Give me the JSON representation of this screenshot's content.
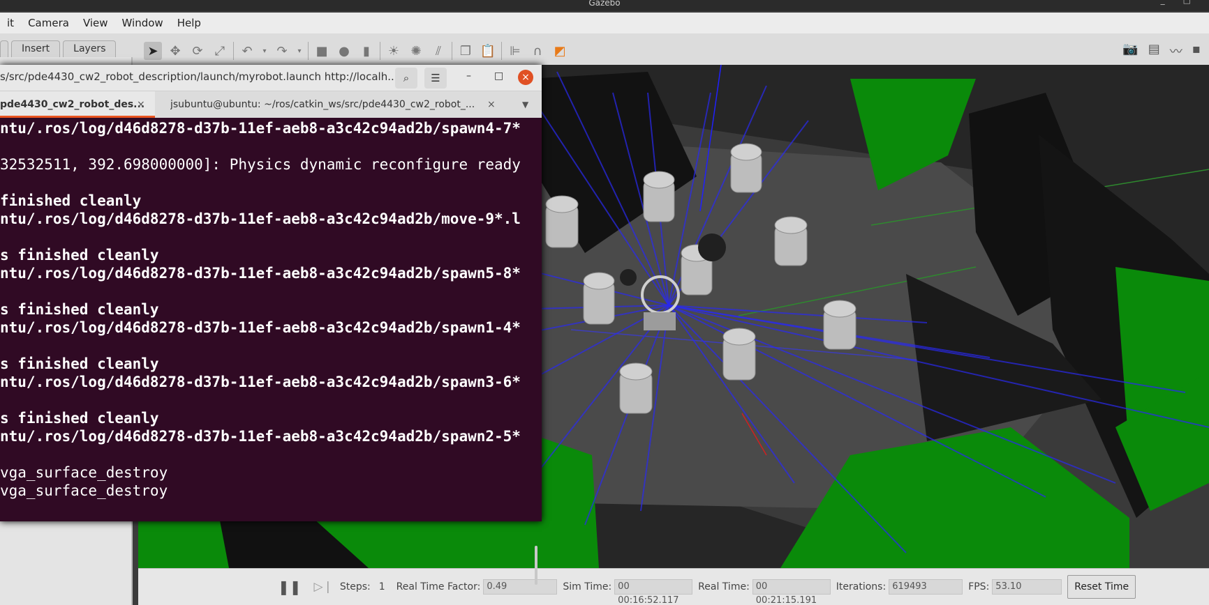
{
  "gazebo": {
    "title": "Gazebo",
    "menu": [
      "it",
      "Camera",
      "View",
      "Window",
      "Help"
    ],
    "left_tabs": [
      "Insert",
      "Layers"
    ],
    "toolbar_icons": [
      "select-arrow-icon",
      "translate-icon",
      "rotate-icon",
      "scale-icon",
      "undo-icon",
      "undo-dropdown-icon",
      "redo-icon",
      "redo-dropdown-icon",
      "box-icon",
      "sphere-icon",
      "cylinder-icon",
      "sun-light-icon",
      "point-light-icon",
      "spot-light-icon",
      "copy-icon",
      "paste-icon",
      "align-icon",
      "magnet-icon",
      "view-angle-icon"
    ],
    "right_icons": [
      "screenshot-icon",
      "log-icon",
      "plot-icon",
      "record-icon"
    ]
  },
  "bottom": {
    "pause_icon": "pause-icon",
    "step_icon": "step-icon",
    "steps_label": "Steps:",
    "steps_value": "1",
    "rtf_label": "Real Time Factor:",
    "rtf_value": "0.49",
    "sim_time_label": "Sim Time:",
    "sim_time_value": "00 00:16:52.117",
    "real_time_label": "Real Time:",
    "real_time_value": "00 00:21:15.191",
    "iterations_label": "Iterations:",
    "iterations_value": "619493",
    "fps_label": "FPS:",
    "fps_value": "53.10",
    "reset_label": "Reset Time"
  },
  "terminal": {
    "title": "s/src/pde4430_cw2_robot_description/launch/myrobot.launch http://localh...",
    "tabs": [
      "pde4430_cw2_robot_des...",
      "jsubuntu@ubuntu: ~/ros/catkin_ws/src/pde4430_cw2_robot_..."
    ],
    "lines": [
      {
        "text": "ntu/.ros/log/d46d8278-d37b-11ef-aeb8-a3c42c94ad2b/spawn4-7*",
        "bold": true
      },
      {
        "text": "",
        "bold": false
      },
      {
        "text": "32532511, 392.698000000]: Physics dynamic reconfigure ready",
        "bold": false
      },
      {
        "text": "",
        "bold": false
      },
      {
        "text": "finished cleanly",
        "bold": true
      },
      {
        "text": "ntu/.ros/log/d46d8278-d37b-11ef-aeb8-a3c42c94ad2b/move-9*.l",
        "bold": true
      },
      {
        "text": "",
        "bold": false
      },
      {
        "text": "s finished cleanly",
        "bold": true
      },
      {
        "text": "ntu/.ros/log/d46d8278-d37b-11ef-aeb8-a3c42c94ad2b/spawn5-8*",
        "bold": true
      },
      {
        "text": "",
        "bold": false
      },
      {
        "text": "s finished cleanly",
        "bold": true
      },
      {
        "text": "ntu/.ros/log/d46d8278-d37b-11ef-aeb8-a3c42c94ad2b/spawn1-4*",
        "bold": true
      },
      {
        "text": "",
        "bold": false
      },
      {
        "text": "s finished cleanly",
        "bold": true
      },
      {
        "text": "ntu/.ros/log/d46d8278-d37b-11ef-aeb8-a3c42c94ad2b/spawn3-6*",
        "bold": true
      },
      {
        "text": "",
        "bold": false
      },
      {
        "text": "s finished cleanly",
        "bold": true
      },
      {
        "text": "ntu/.ros/log/d46d8278-d37b-11ef-aeb8-a3c42c94ad2b/spawn2-5*",
        "bold": true
      },
      {
        "text": "",
        "bold": false
      },
      {
        "text": "vga_surface_destroy",
        "bold": false
      },
      {
        "text": "vga_surface_destroy",
        "bold": false
      }
    ]
  },
  "colors": {
    "terminal_bg": "#300a24",
    "accent": "#e95420",
    "close": "#e05024",
    "laser": "#2a2af0",
    "obstacle": "#0a8a0a"
  }
}
